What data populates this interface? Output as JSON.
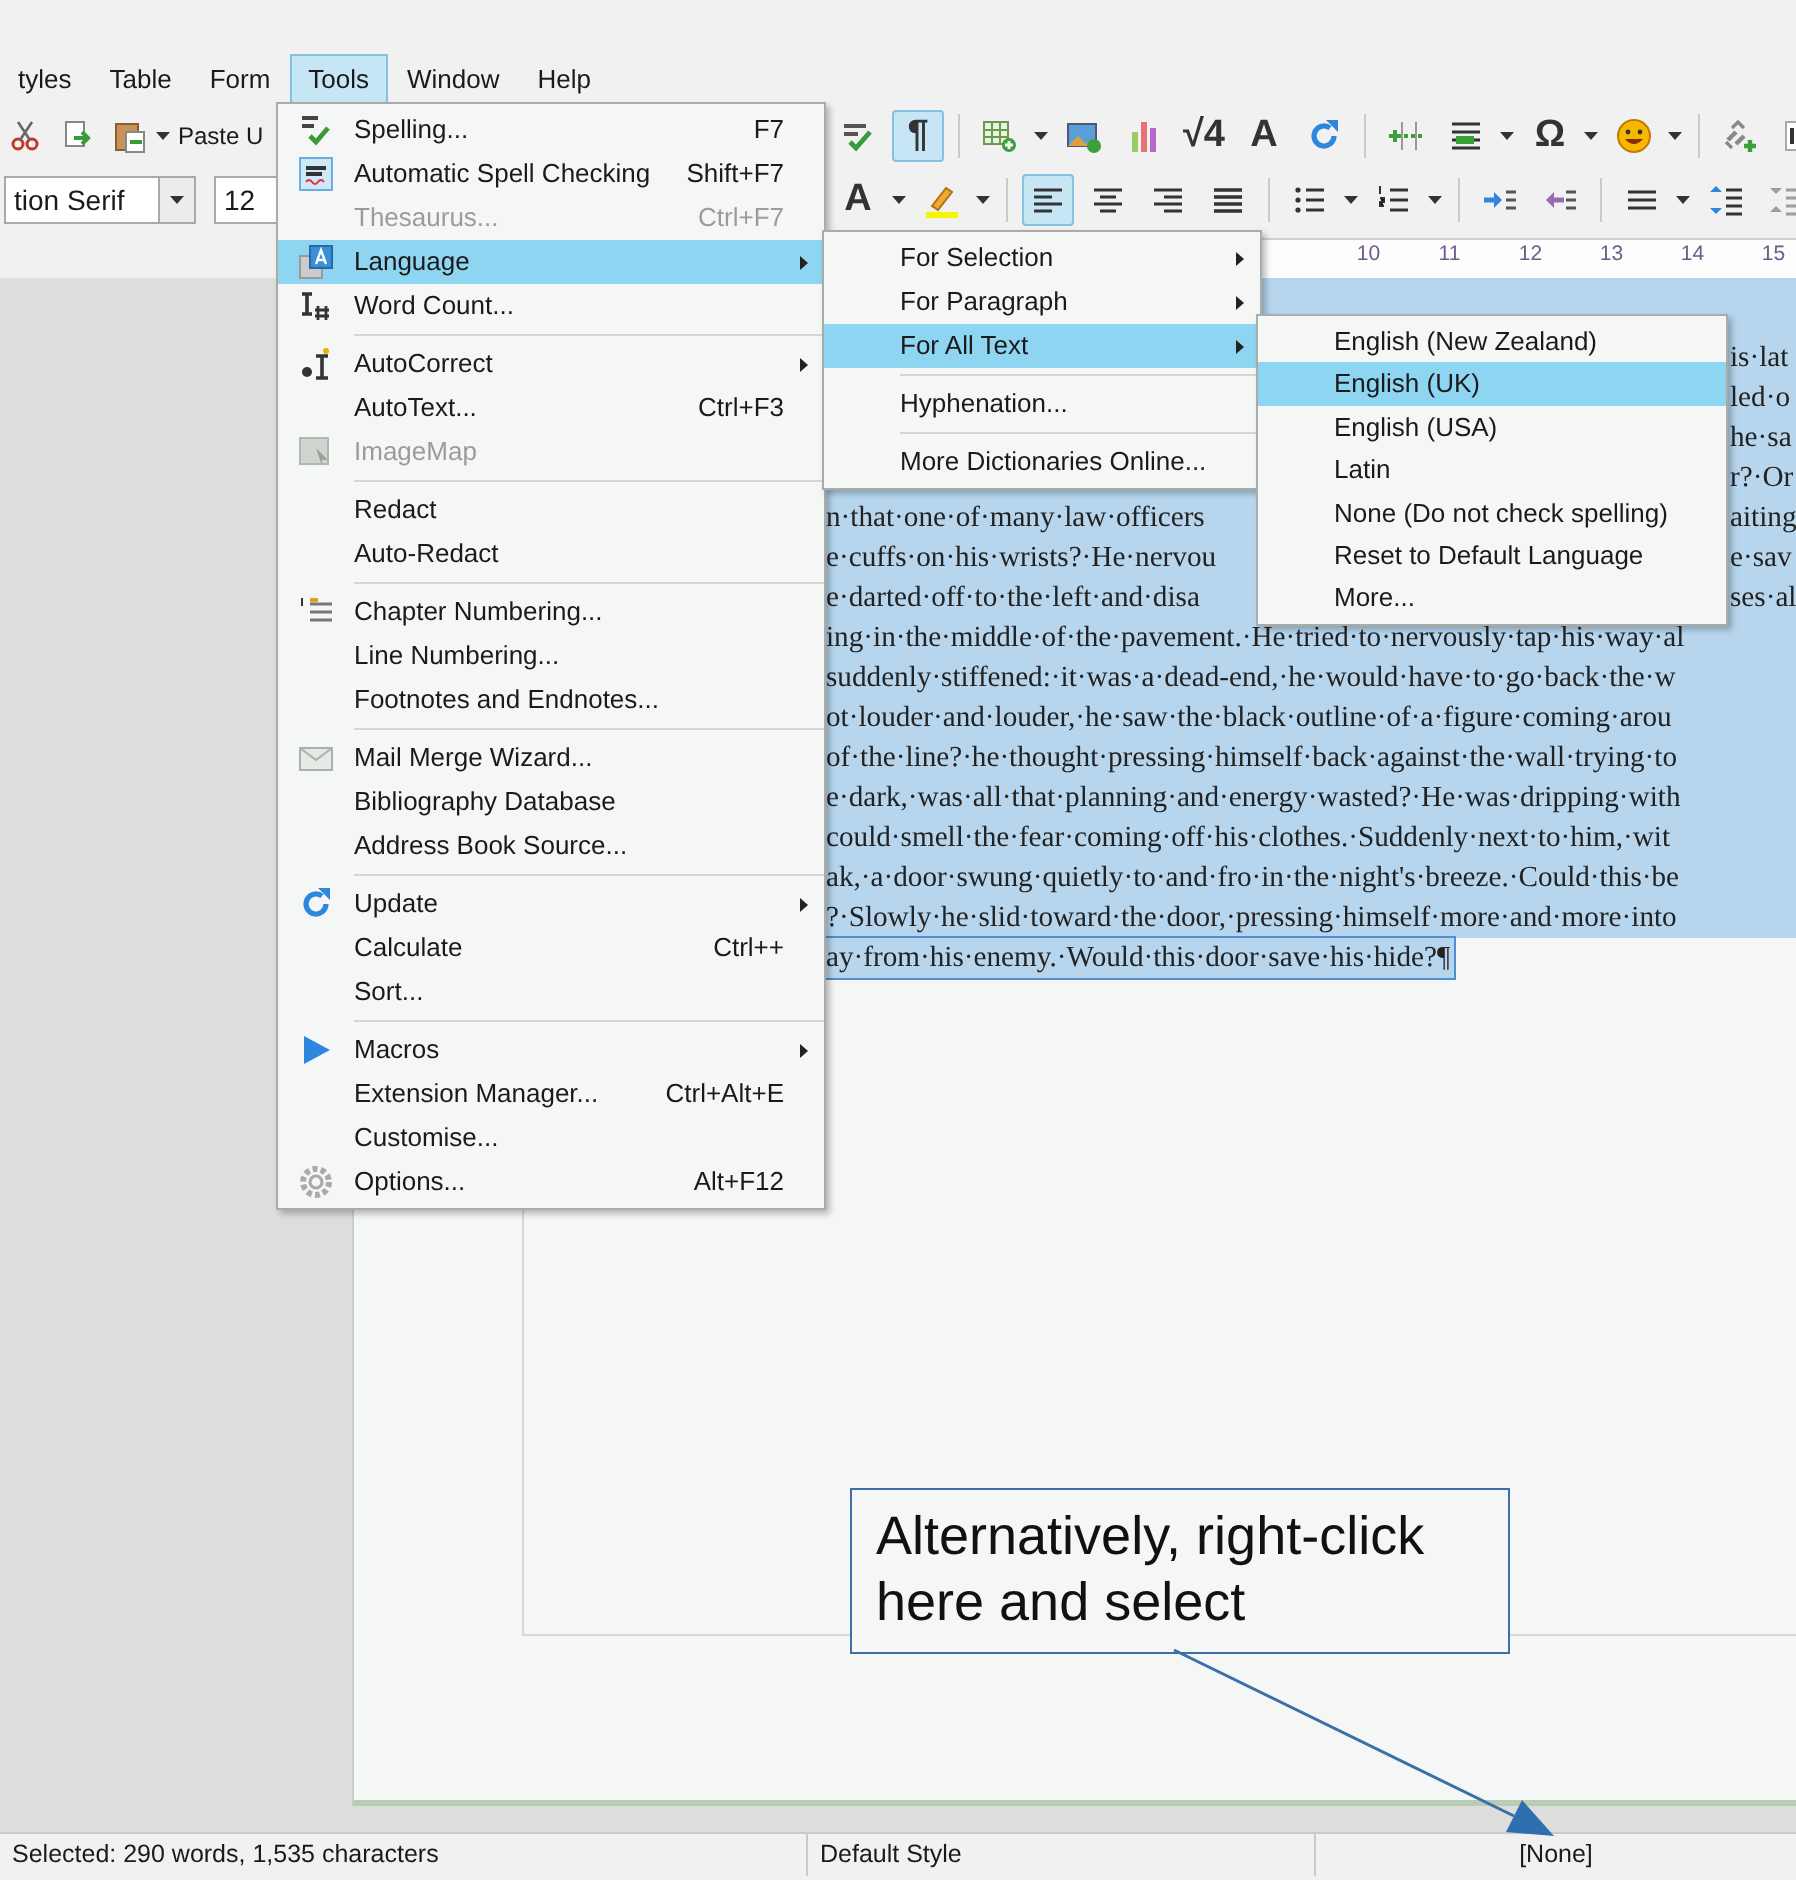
{
  "menubar": [
    {
      "label": "tyles",
      "selected": false
    },
    {
      "label": "Table",
      "selected": false
    },
    {
      "label": "Form",
      "selected": false
    },
    {
      "label": "Tools",
      "selected": true
    },
    {
      "label": "Window",
      "selected": false
    },
    {
      "label": "Help",
      "selected": false
    }
  ],
  "toolbar_standard": {
    "left": [
      {
        "kind": "button",
        "on": false
      },
      {
        "kind": "button",
        "on": false
      },
      {
        "kind": "button",
        "on": false
      }
    ],
    "paste_label": "Paste U",
    "right": [
      {
        "kind": "button",
        "on": false
      },
      {
        "kind": "glyph",
        "glyph": "¶",
        "on": true
      },
      {
        "kind": "separator"
      },
      {
        "kind": "button",
        "on": false
      },
      {
        "kind": "button",
        "on": false
      },
      {
        "kind": "button",
        "on": false
      },
      {
        "kind": "glyph",
        "glyph": "√4",
        "on": false
      },
      {
        "kind": "glyph",
        "glyph": "A",
        "on": false
      },
      {
        "kind": "button",
        "on": false
      },
      {
        "kind": "separator"
      },
      {
        "kind": "button",
        "on": false
      },
      {
        "kind": "button",
        "on": false
      },
      {
        "kind": "glyph",
        "glyph": "Ω",
        "on": false
      },
      {
        "kind": "button",
        "on": false
      },
      {
        "kind": "separator"
      },
      {
        "kind": "button",
        "on": false
      },
      {
        "kind": "button",
        "on": false
      }
    ]
  },
  "toolbar_formatting": {
    "font_name": "tion Serif",
    "font_size": "12",
    "right": [
      {
        "kind": "glyph",
        "glyph": "A",
        "on": false
      },
      {
        "kind": "button",
        "on": false
      },
      {
        "kind": "separator"
      },
      {
        "kind": "button",
        "on": true
      },
      {
        "kind": "button",
        "on": false
      },
      {
        "kind": "button",
        "on": false
      },
      {
        "kind": "button",
        "on": false
      },
      {
        "kind": "separator"
      },
      {
        "kind": "button",
        "on": false
      },
      {
        "kind": "button",
        "on": false
      },
      {
        "kind": "separator"
      },
      {
        "kind": "button",
        "on": false
      },
      {
        "kind": "button",
        "on": false
      },
      {
        "kind": "separator"
      },
      {
        "kind": "button",
        "on": false
      },
      {
        "kind": "button",
        "on": false
      },
      {
        "kind": "button",
        "on": false
      }
    ]
  },
  "ruler": [
    "10",
    "11",
    "12",
    "13",
    "14",
    "15"
  ],
  "document_lines": [
    {
      "tail": "is·lat"
    },
    {
      "tail": "led·o"
    },
    {
      "tail": "he·sa"
    },
    {
      "tail": "r?·Or"
    },
    {
      "text": "n·that·one·of·many·law·officers",
      "tail": "aiting"
    },
    {
      "text": "e·cuffs·on·his·wrists?·He·nervou",
      "tail": "e·sav"
    },
    {
      "text": "e·darted·off·to·the·left·and·disa",
      "tail": "ses·al"
    },
    {
      "text": "ing·in·the·middle·of·the·pavement.·He·tried·to·nervously·tap·his·way·al"
    },
    {
      "text": "suddenly·stiffened:·it·was·a·dead-end,·he·would·have·to·go·back·the·w"
    },
    {
      "text": "ot·louder·and·louder,·he·saw·the·black·outline·of·a·figure·coming·arou"
    },
    {
      "text": "of·the·line?·he·thought·pressing·himself·back·against·the·wall·trying·to"
    },
    {
      "text": "e·dark,·was·all·that·planning·and·energy·wasted?·He·was·dripping·with"
    },
    {
      "text": "could·smell·the·fear·coming·off·his·clothes.·Suddenly·next·to·him,·wit"
    },
    {
      "text": "ak,·a·door·swung·quietly·to·and·fro·in·the·night's·breeze.·Could·this·be"
    },
    {
      "text": "?·Slowly·he·slid·toward·the·door,·pressing·himself·more·and·more·into"
    },
    {
      "text": "ay·from·his·enemy.·Would·this·door·save·his·hide?¶"
    }
  ],
  "tools_menu": {
    "items": [
      {
        "kind": "item",
        "label": "Spelling...",
        "shortcut": "F7",
        "submenu": false,
        "disabled": false,
        "highlighted": false
      },
      {
        "kind": "item",
        "label": "Automatic Spell Checking",
        "shortcut": "Shift+F7",
        "submenu": false,
        "disabled": false,
        "highlighted": false
      },
      {
        "kind": "item",
        "label": "Thesaurus...",
        "shortcut": "Ctrl+F7",
        "submenu": false,
        "disabled": true,
        "highlighted": false
      },
      {
        "kind": "item",
        "label": "Language",
        "submenu": true,
        "disabled": false,
        "highlighted": true
      },
      {
        "kind": "item",
        "label": "Word Count...",
        "submenu": false,
        "disabled": false,
        "highlighted": false
      },
      {
        "kind": "separator"
      },
      {
        "kind": "item",
        "label": "AutoCorrect",
        "submenu": true,
        "disabled": false,
        "highlighted": false
      },
      {
        "kind": "item",
        "label": "AutoText...",
        "shortcut": "Ctrl+F3",
        "submenu": false,
        "disabled": false,
        "highlighted": false
      },
      {
        "kind": "item",
        "label": "ImageMap",
        "submenu": false,
        "disabled": true,
        "highlighted": false
      },
      {
        "kind": "separator"
      },
      {
        "kind": "item",
        "label": "Redact",
        "submenu": false,
        "disabled": false,
        "highlighted": false
      },
      {
        "kind": "item",
        "label": "Auto-Redact",
        "submenu": false,
        "disabled": false,
        "highlighted": false
      },
      {
        "kind": "separator"
      },
      {
        "kind": "item",
        "label": "Chapter Numbering...",
        "submenu": false,
        "disabled": false,
        "highlighted": false
      },
      {
        "kind": "item",
        "label": "Line Numbering...",
        "submenu": false,
        "disabled": false,
        "highlighted": false
      },
      {
        "kind": "item",
        "label": "Footnotes and Endnotes...",
        "submenu": false,
        "disabled": false,
        "highlighted": false
      },
      {
        "kind": "separator"
      },
      {
        "kind": "item",
        "label": "Mail Merge Wizard...",
        "submenu": false,
        "disabled": false,
        "highlighted": false
      },
      {
        "kind": "item",
        "label": "Bibliography Database",
        "submenu": false,
        "disabled": false,
        "highlighted": false
      },
      {
        "kind": "item",
        "label": "Address Book Source...",
        "submenu": false,
        "disabled": false,
        "highlighted": false
      },
      {
        "kind": "separator"
      },
      {
        "kind": "item",
        "label": "Update",
        "submenu": true,
        "disabled": false,
        "highlighted": false
      },
      {
        "kind": "item",
        "label": "Calculate",
        "shortcut": "Ctrl++",
        "submenu": false,
        "disabled": false,
        "highlighted": false
      },
      {
        "kind": "item",
        "label": "Sort...",
        "submenu": false,
        "disabled": false,
        "highlighted": false
      },
      {
        "kind": "separator"
      },
      {
        "kind": "item",
        "label": "Macros",
        "submenu": true,
        "disabled": false,
        "highlighted": false
      },
      {
        "kind": "item",
        "label": "Extension Manager...",
        "shortcut": "Ctrl+Alt+E",
        "submenu": false,
        "disabled": false,
        "highlighted": false
      },
      {
        "kind": "item",
        "label": "Customise...",
        "submenu": false,
        "disabled": false,
        "highlighted": false
      },
      {
        "kind": "item",
        "label": "Options...",
        "shortcut": "Alt+F12",
        "submenu": false,
        "disabled": false,
        "highlighted": false
      }
    ]
  },
  "language_submenu": {
    "items": [
      {
        "kind": "item",
        "label": "For Selection",
        "submenu": true,
        "highlighted": false
      },
      {
        "kind": "item",
        "label": "For Paragraph",
        "submenu": true,
        "highlighted": false
      },
      {
        "kind": "item",
        "label": "For All Text",
        "submenu": true,
        "highlighted": true
      },
      {
        "kind": "separator"
      },
      {
        "kind": "item",
        "label": "Hyphenation...",
        "submenu": false,
        "highlighted": false
      },
      {
        "kind": "separator"
      },
      {
        "kind": "item",
        "label": "More Dictionaries Online...",
        "submenu": false,
        "highlighted": false
      }
    ]
  },
  "all_text_submenu": {
    "items": [
      {
        "label": "English (New Zealand)",
        "highlighted": false
      },
      {
        "label": "English (UK)",
        "highlighted": true
      },
      {
        "label": "English (USA)",
        "highlighted": false
      },
      {
        "label": "Latin",
        "highlighted": false
      },
      {
        "label": "None (Do not check spelling)",
        "highlighted": false
      },
      {
        "label": "Reset to Default Language",
        "highlighted": false
      },
      {
        "label": "More...",
        "highlighted": false
      }
    ]
  },
  "callout": {
    "text": "Alternatively, right-click here and select"
  },
  "status_bar": {
    "selection": "Selected: 290 words, 1,535 characters",
    "page_style": "Default Style",
    "language": "[None]"
  }
}
